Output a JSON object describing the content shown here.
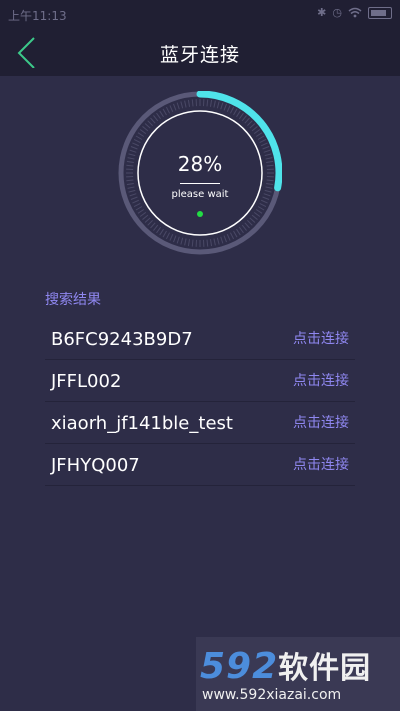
{
  "status_bar": {
    "time": "上午11:13",
    "icons": [
      "bluetooth-icon",
      "alarm-icon",
      "wifi-icon",
      "battery-icon"
    ]
  },
  "header": {
    "title": "蓝牙连接"
  },
  "progress": {
    "percent_text": "28%",
    "percent_value": 28,
    "message": "please wait"
  },
  "results": {
    "label": "搜索结果",
    "devices": [
      {
        "name": "B6FC9243B9D7",
        "action": "点击连接"
      },
      {
        "name": "JFFL002",
        "action": "点击连接"
      },
      {
        "name": "xiaorh_jf141ble_test",
        "action": "点击连接"
      },
      {
        "name": "JFHYQ007",
        "action": "点击连接"
      }
    ]
  },
  "watermark": {
    "brand_num": "592",
    "brand_cn": "软件园",
    "url": "www.592xiazai.com"
  },
  "colors": {
    "background": "#2e2d48",
    "header": "#201f33",
    "accent_cyan": "#4fe3ea",
    "accent_purple": "#8f87f0",
    "back_green": "#3cc98a",
    "dot_green": "#22dd44"
  }
}
